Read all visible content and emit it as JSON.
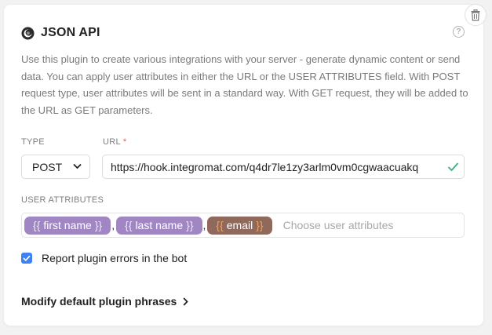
{
  "plugin": {
    "title": "JSON API",
    "help_symbol": "?",
    "description": "Use this plugin to create various integrations with your server - generate dynamic content or send data. You can apply user attributes in either the URL or the USER ATTRIBUTES field. With POST request type, user attributes will be sent in a standard way. With GET request, they will be added to the URL as GET parameters."
  },
  "form": {
    "type_label": "TYPE",
    "type_value": "POST",
    "url_label": "URL",
    "url_required_mark": "*",
    "url_value": "https://hook.integromat.com/q4dr7le1zy3arlm0vm0cgwaacuakq",
    "attributes_label": "USER ATTRIBUTES",
    "attributes": [
      {
        "name": "first name",
        "color": "#a087c4"
      },
      {
        "name": "last name",
        "color": "#a087c4"
      },
      {
        "name": "email",
        "color": "#8f6a5c"
      }
    ],
    "attr_open": "{{",
    "attr_close": "}}",
    "separator": ",",
    "attributes_placeholder": "Choose user attributes",
    "report_errors_label": "Report plugin errors in the bot",
    "report_errors_checked": true
  },
  "footer": {
    "modify_phrases_label": "Modify default plugin phrases"
  },
  "colors": {
    "accent": "#3b82f6",
    "valid": "#3fb27f",
    "required": "#e2574c"
  }
}
